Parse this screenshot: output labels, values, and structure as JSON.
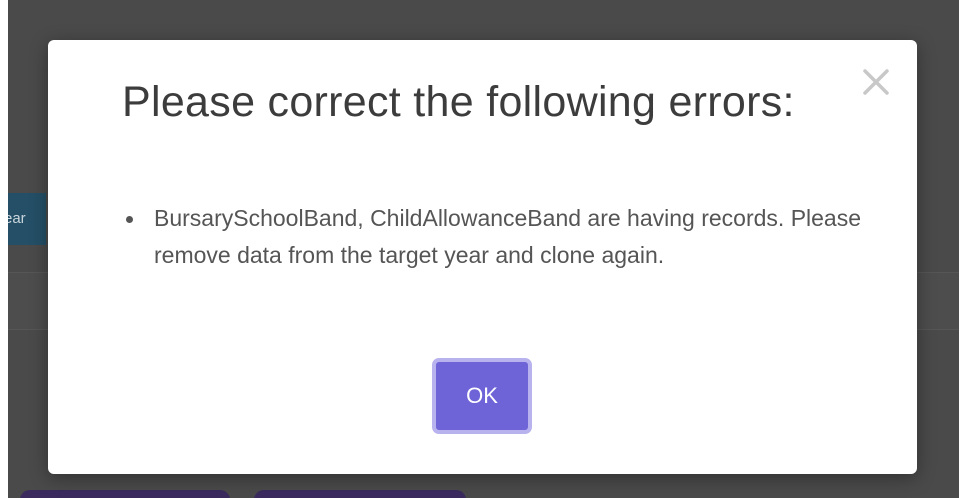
{
  "background": {
    "tab_fragment": "ear"
  },
  "dialog": {
    "title": "Please correct the following errors:",
    "close_icon": "close-icon",
    "errors": [
      "BursarySchoolBand, ChildAllowanceBand are having records. Please remove data from the target year and clone again."
    ],
    "ok_label": "OK"
  },
  "colors": {
    "overlay": "#4a4a4a",
    "primary_button": "#6e64d8",
    "button_focus_ring": "#b8b2ee",
    "title_text": "#3c3c3c",
    "body_text": "#555555",
    "background_tab": "#244f66"
  }
}
